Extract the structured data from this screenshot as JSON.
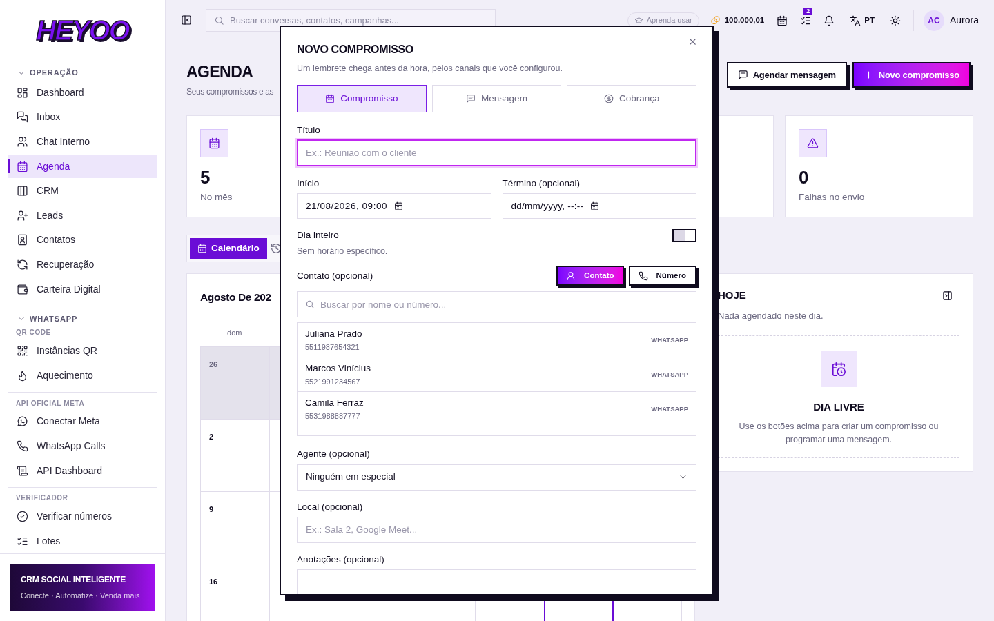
{
  "sidebar": {
    "logo": "HEYOO",
    "groups": [
      {
        "kind": "section",
        "title": "OPERAÇÃO",
        "expanded": true,
        "items": [
          {
            "label": "Dashboard",
            "selected": false
          },
          {
            "label": "Inbox",
            "selected": false
          },
          {
            "label": "Chat Interno",
            "selected": false
          },
          {
            "label": "Agenda",
            "selected": true
          },
          {
            "label": "CRM",
            "selected": false
          },
          {
            "label": "Leads",
            "selected": false
          },
          {
            "label": "Contatos",
            "selected": false
          },
          {
            "label": "Recuperação",
            "selected": false
          },
          {
            "label": "Carteira Digital",
            "selected": false
          }
        ]
      },
      {
        "kind": "section",
        "title": "WHATSAPP",
        "expanded": true
      },
      {
        "kind": "group",
        "title": "QR CODE",
        "items": [
          {
            "label": "Instâncias QR",
            "selected": false
          },
          {
            "label": "Aquecimento",
            "selected": false
          }
        ]
      },
      {
        "kind": "group",
        "title": "API OFICIAL META",
        "items": [
          {
            "label": "Conectar Meta",
            "selected": false
          },
          {
            "label": "WhatsApp Calls",
            "selected": false
          },
          {
            "label": "API Dashboard",
            "selected": false
          }
        ]
      },
      {
        "kind": "group",
        "title": "VERIFICADOR",
        "items": [
          {
            "label": "Verificar números",
            "selected": false
          },
          {
            "label": "Lotes",
            "selected": false
          }
        ]
      }
    ],
    "promo": {
      "title": "CRM SOCIAL INTELIGENTE",
      "subtitle": "Conecte · Automatize · Venda mais"
    }
  },
  "topbar": {
    "search_placeholder": "Buscar conversas, contatos, campanhas...",
    "learn_button": "Aprenda usar",
    "balance": "100.000,01",
    "tasks_badge": "2",
    "language": "PT",
    "avatar": "AC",
    "user": "Aurora"
  },
  "page": {
    "title": "AGENDA",
    "subtitle": "Seus compromissos e as",
    "actions": [
      {
        "label": "Agendar mensagem",
        "kind": "secondary"
      },
      {
        "label": "Novo compromisso",
        "kind": "primary"
      }
    ],
    "stats": [
      {
        "value": "5",
        "label": "No mês"
      },
      {
        "value": "0",
        "label": "Falhas no envio"
      }
    ],
    "views": [
      {
        "label": "Calendário",
        "selected": true
      }
    ],
    "calendar": {
      "title": "Agosto De 202",
      "weekday": "dom",
      "weeks": [
        {
          "day": "26",
          "outside_month": true
        },
        {
          "day": "2",
          "outside_month": false
        },
        {
          "day": "9",
          "outside_month": false
        },
        {
          "day": "16",
          "outside_month": false,
          "today_in_week": true
        }
      ]
    },
    "today_panel": {
      "title": "HOJE",
      "subtitle": "Nada agendado neste dia.",
      "empty_title": "DIA LIVRE",
      "empty_text": "Use os botões acima para criar um compromisso ou programar uma mensagem."
    }
  },
  "modal": {
    "title": "NOVO COMPROMISSO",
    "subtitle": "Um lembrete chega antes da hora, pelos canais que você configurou.",
    "tabs": [
      {
        "label": "Compromisso",
        "selected": true
      },
      {
        "label": "Mensagem",
        "selected": false
      },
      {
        "label": "Cobrança",
        "selected": false
      }
    ],
    "title_field": {
      "label": "Título",
      "placeholder": "Ex.: Reunião com o cliente"
    },
    "start": {
      "label": "Início",
      "value": "21/08/2026, 09:00"
    },
    "end": {
      "label": "Término (opcional)",
      "value": "dd/mm/yyyy, --:--"
    },
    "all_day": {
      "label": "Dia inteiro",
      "hint": "Sem horário específico.",
      "on": false
    },
    "contact": {
      "label": "Contato (opcional)",
      "modes": [
        {
          "label": "Contato",
          "selected": true
        },
        {
          "label": "Número",
          "selected": false
        }
      ],
      "search_placeholder": "Buscar por nome ou número...",
      "results": [
        {
          "name": "Juliana Prado",
          "number": "5511987654321",
          "channel": "WHATSAPP"
        },
        {
          "name": "Marcos Vinícius",
          "number": "5521991234567",
          "channel": "WHATSAPP"
        },
        {
          "name": "Camila Ferraz",
          "number": "5531988887777",
          "channel": "WHATSAPP"
        }
      ]
    },
    "agent": {
      "label": "Agente (opcional)",
      "value": "Ninguém em especial"
    },
    "location": {
      "label": "Local (opcional)",
      "placeholder": "Ex.: Sala 2, Google Meet..."
    },
    "notes": {
      "label": "Anotações (opcional)"
    }
  }
}
